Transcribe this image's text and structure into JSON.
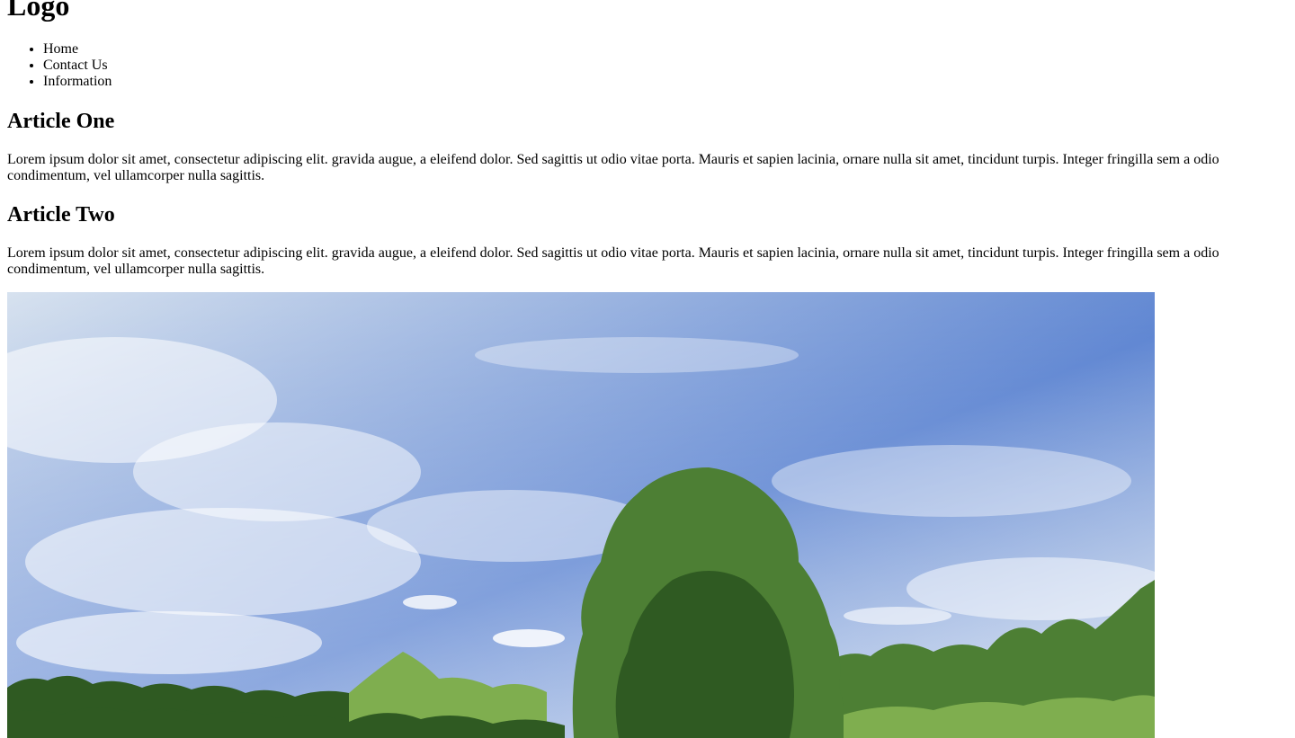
{
  "header": {
    "logo": "Logo"
  },
  "nav": {
    "items": [
      {
        "label": "Home"
      },
      {
        "label": "Contact Us"
      },
      {
        "label": "Information"
      }
    ]
  },
  "articles": [
    {
      "title": "Article One",
      "body": "Lorem ipsum dolor sit amet, consectetur adipiscing elit. gravida augue, a eleifend dolor. Sed sagittis ut odio vitae porta. Mauris et sapien lacinia, ornare nulla sit amet, tincidunt turpis. Integer fringilla sem a odio condimentum, vel ullamcorper nulla sagittis."
    },
    {
      "title": "Article Two",
      "body": "Lorem ipsum dolor sit amet, consectetur adipiscing elit. gravida augue, a eleifend dolor. Sed sagittis ut odio vitae porta. Mauris et sapien lacinia, ornare nulla sit amet, tincidunt turpis. Integer fringilla sem a odio condimentum, vel ullamcorper nulla sagittis."
    }
  ],
  "colors": {
    "sky_top": "#5b83d1",
    "sky_light": "#d7e2ef",
    "foliage_dark": "#2f5a22",
    "foliage_mid": "#4d7f34",
    "foliage_light": "#7fae4f"
  }
}
